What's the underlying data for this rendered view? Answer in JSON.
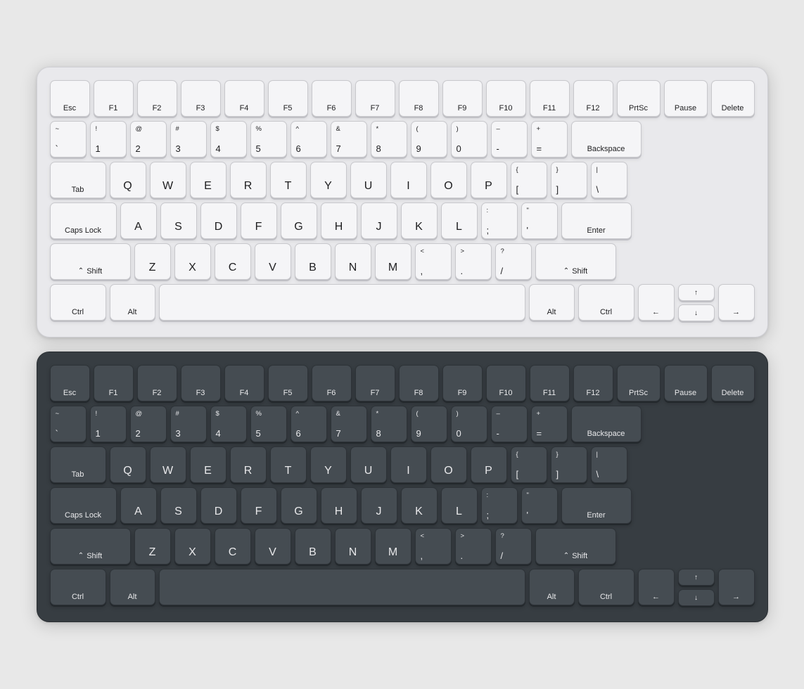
{
  "keyboards": [
    {
      "id": "light",
      "theme": "light",
      "rows": {
        "fn": [
          "Esc",
          "F1",
          "F2",
          "F3",
          "F4",
          "F5",
          "F6",
          "F7",
          "F8",
          "F9",
          "F10",
          "F11",
          "F12",
          "PrtSc",
          "Pause",
          "Delete"
        ],
        "num": [
          {
            "top": "~",
            "bot": "`"
          },
          {
            "top": "!",
            "bot": "1"
          },
          {
            "top": "@",
            "bot": "2"
          },
          {
            "top": "#",
            "bot": "3"
          },
          {
            "top": "$",
            "bot": "4"
          },
          {
            "top": "%",
            "bot": "5"
          },
          {
            "top": "^",
            "bot": "6"
          },
          {
            "top": "&",
            "bot": "7"
          },
          {
            "top": "*",
            "bot": "8"
          },
          {
            "top": "(",
            "bot": "9"
          },
          {
            "top": ")",
            "bot": "0"
          },
          {
            "top": "–",
            "bot": "-"
          },
          {
            "top": "+",
            "bot": "="
          },
          {
            "top": "Backspace",
            "bot": ""
          }
        ],
        "qwerty": [
          "Tab",
          "Q",
          "W",
          "E",
          "R",
          "T",
          "Y",
          "U",
          "I",
          "O",
          "P",
          "{  [",
          "} ]",
          "| \\"
        ],
        "asdf": [
          "Caps Lock",
          "A",
          "S",
          "D",
          "F",
          "G",
          "H",
          "J",
          "K",
          "L",
          ":  ;",
          "\"  '",
          "Enter"
        ],
        "zxcv": [
          "Shift",
          "Z",
          "X",
          "C",
          "V",
          "B",
          "N",
          "M",
          "<  ,",
          ">  .",
          "?  /",
          "Shift"
        ],
        "ctrl": [
          "Ctrl",
          "Alt",
          "Space",
          "Alt",
          "Ctrl"
        ]
      }
    },
    {
      "id": "dark",
      "theme": "dark",
      "rows": {
        "fn": [
          "Esc",
          "F1",
          "F2",
          "F3",
          "F4",
          "F5",
          "F6",
          "F7",
          "F8",
          "F9",
          "F10",
          "F11",
          "F12",
          "PrtSc",
          "Pause",
          "Delete"
        ],
        "num": [
          {
            "top": "~",
            "bot": "`"
          },
          {
            "top": "!",
            "bot": "1"
          },
          {
            "top": "@",
            "bot": "2"
          },
          {
            "top": "#",
            "bot": "3"
          },
          {
            "top": "$",
            "bot": "4"
          },
          {
            "top": "%",
            "bot": "5"
          },
          {
            "top": "^",
            "bot": "6"
          },
          {
            "top": "&",
            "bot": "7"
          },
          {
            "top": "*",
            "bot": "8"
          },
          {
            "top": "(",
            "bot": "9"
          },
          {
            "top": ")",
            "bot": "0"
          },
          {
            "top": "–",
            "bot": "-"
          },
          {
            "top": "+",
            "bot": "="
          },
          {
            "top": "Backspace",
            "bot": ""
          }
        ],
        "qwerty": [
          "Tab",
          "Q",
          "W",
          "E",
          "R",
          "T",
          "Y",
          "U",
          "I",
          "O",
          "P",
          "{  [",
          "} ]",
          "| \\"
        ],
        "asdf": [
          "Caps Lock",
          "A",
          "S",
          "D",
          "F",
          "G",
          "H",
          "J",
          "K",
          "L",
          ":  ;",
          "\"  '",
          "Enter"
        ],
        "zxcv": [
          "Shift",
          "Z",
          "X",
          "C",
          "V",
          "B",
          "N",
          "M",
          "<  ,",
          ">  .",
          "?  /",
          "Shift"
        ],
        "ctrl": [
          "Ctrl",
          "Alt",
          "Space",
          "Alt",
          "Ctrl"
        ]
      }
    }
  ]
}
